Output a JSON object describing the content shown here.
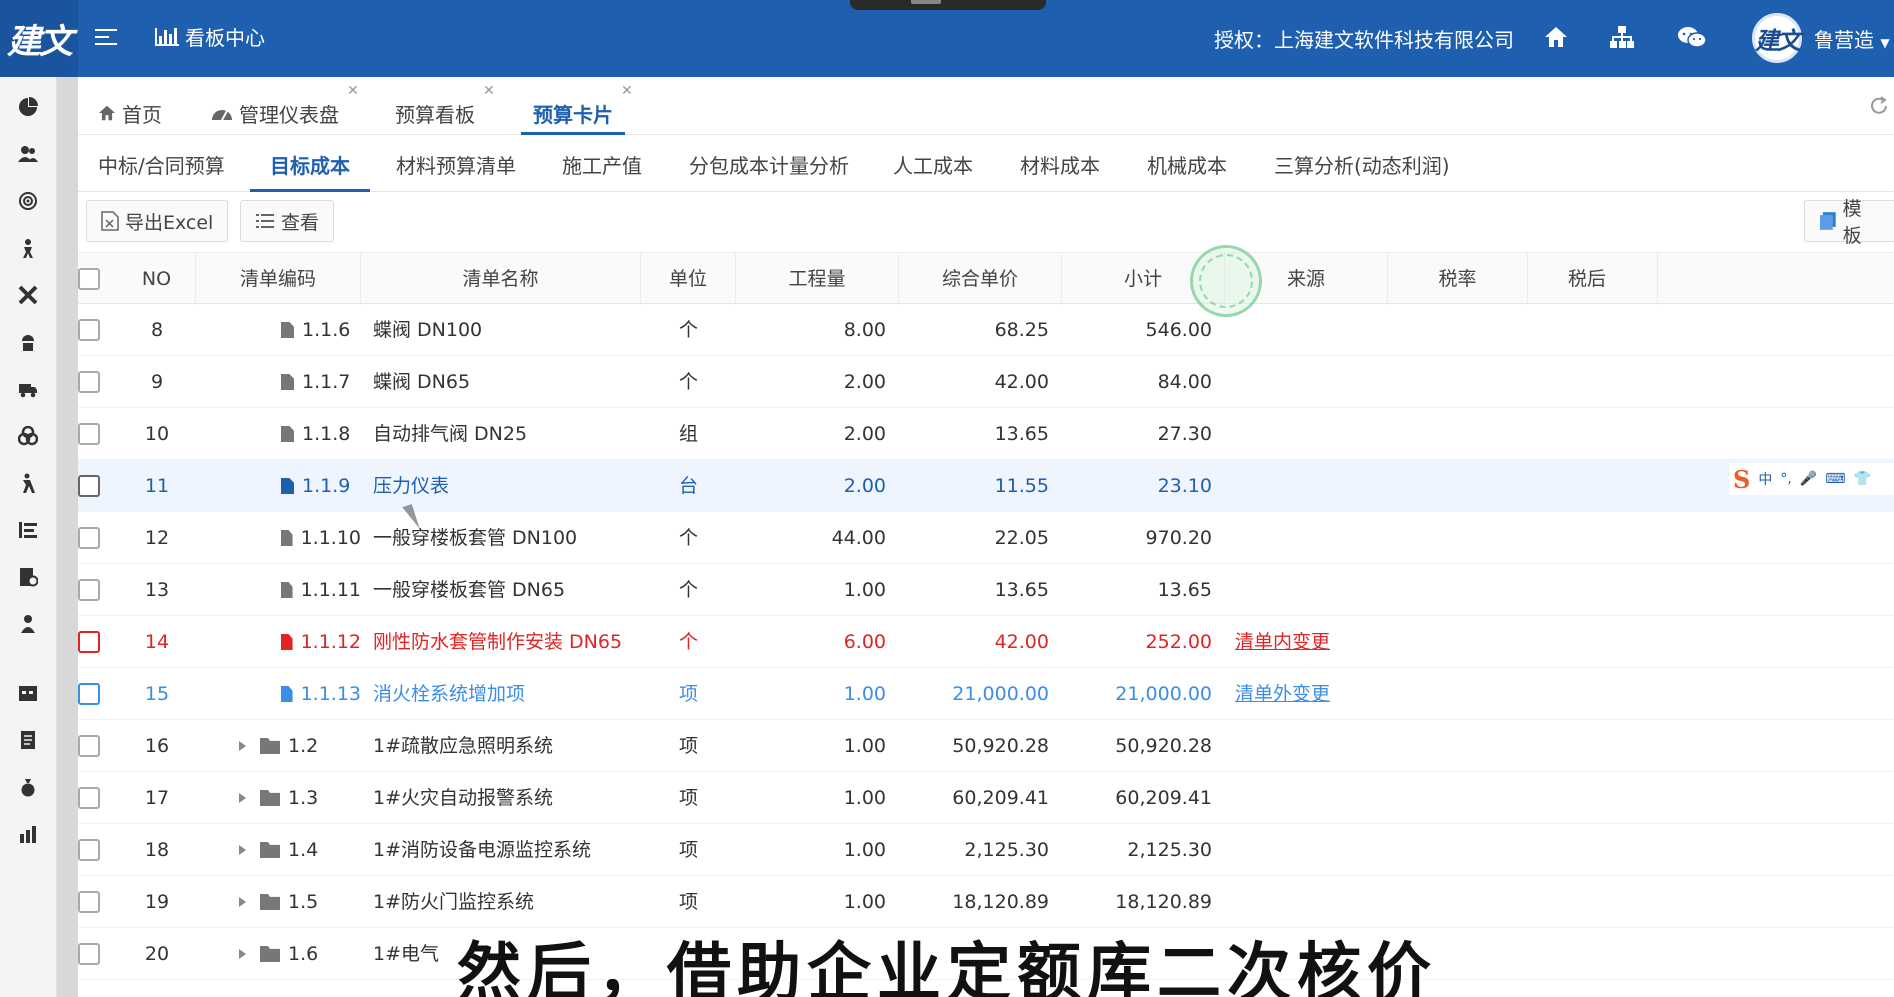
{
  "app": {
    "logo_text": "建文",
    "nav_title": "看板中心",
    "auth_text": "授权：上海建文软件科技有限公司",
    "avatar_text": "建文",
    "username": "鲁营造"
  },
  "tabs": [
    {
      "label": "首页",
      "icon": "home-icon",
      "closable": false,
      "active": false
    },
    {
      "label": "管理仪表盘",
      "icon": "dashboard-icon",
      "closable": true,
      "active": false
    },
    {
      "label": "预算看板",
      "closable": true,
      "active": false
    },
    {
      "label": "预算卡片",
      "closable": true,
      "active": true
    }
  ],
  "subtabs": [
    {
      "label": "中标/合同预算",
      "active": false
    },
    {
      "label": "目标成本",
      "active": true
    },
    {
      "label": "材料预算清单",
      "active": false
    },
    {
      "label": "施工产值",
      "active": false
    },
    {
      "label": "分包成本计量分析",
      "active": false
    },
    {
      "label": "人工成本",
      "active": false
    },
    {
      "label": "材料成本",
      "active": false
    },
    {
      "label": "机械成本",
      "active": false
    },
    {
      "label": "三算分析(动态利润)",
      "active": false
    }
  ],
  "toolbar": {
    "export_label": "导出Excel",
    "view_label": "查看",
    "template_label": "模板"
  },
  "table": {
    "headers": [
      "NO",
      "清单编码",
      "清单名称",
      "单位",
      "工程量",
      "综合单价",
      "小计",
      "来源",
      "税率",
      "税后"
    ],
    "rows": [
      {
        "no": "8",
        "code": "1.1.6",
        "name": "蝶阀 DN100",
        "unit": "个",
        "qty": "8.00",
        "price": "68.25",
        "subtotal": "546.00",
        "source": "",
        "type": "item",
        "style": "normal"
      },
      {
        "no": "9",
        "code": "1.1.7",
        "name": "蝶阀 DN65",
        "unit": "个",
        "qty": "2.00",
        "price": "42.00",
        "subtotal": "84.00",
        "source": "",
        "type": "item",
        "style": "normal"
      },
      {
        "no": "10",
        "code": "1.1.8",
        "name": "自动排气阀 DN25",
        "unit": "组",
        "qty": "2.00",
        "price": "13.65",
        "subtotal": "27.30",
        "source": "",
        "type": "item",
        "style": "normal"
      },
      {
        "no": "11",
        "code": "1.1.9",
        "name": "压力仪表",
        "unit": "台",
        "qty": "2.00",
        "price": "11.55",
        "subtotal": "23.10",
        "source": "",
        "type": "item",
        "style": "selected"
      },
      {
        "no": "12",
        "code": "1.1.10",
        "name": "一般穿楼板套管 DN100",
        "unit": "个",
        "qty": "44.00",
        "price": "22.05",
        "subtotal": "970.20",
        "source": "",
        "type": "item",
        "style": "normal"
      },
      {
        "no": "13",
        "code": "1.1.11",
        "name": "一般穿楼板套管 DN65",
        "unit": "个",
        "qty": "1.00",
        "price": "13.65",
        "subtotal": "13.65",
        "source": "",
        "type": "item",
        "style": "normal"
      },
      {
        "no": "14",
        "code": "1.1.12",
        "name": "刚性防水套管制作安装 DN65",
        "unit": "个",
        "qty": "6.00",
        "price": "42.00",
        "subtotal": "252.00",
        "source": "清单内变更",
        "type": "item",
        "style": "red"
      },
      {
        "no": "15",
        "code": "1.1.13",
        "name": "消火栓系统增加项",
        "unit": "项",
        "qty": "1.00",
        "price": "21,000.00",
        "subtotal": "21,000.00",
        "source": "清单外变更",
        "type": "item",
        "style": "blue"
      },
      {
        "no": "16",
        "code": "1.2",
        "name": "1#疏散应急照明系统",
        "unit": "项",
        "qty": "1.00",
        "price": "50,920.28",
        "subtotal": "50,920.28",
        "source": "",
        "type": "folder",
        "style": "normal"
      },
      {
        "no": "17",
        "code": "1.3",
        "name": "1#火灾自动报警系统",
        "unit": "项",
        "qty": "1.00",
        "price": "60,209.41",
        "subtotal": "60,209.41",
        "source": "",
        "type": "folder",
        "style": "normal"
      },
      {
        "no": "18",
        "code": "1.4",
        "name": "1#消防设备电源监控系统",
        "unit": "项",
        "qty": "1.00",
        "price": "2,125.30",
        "subtotal": "2,125.30",
        "source": "",
        "type": "folder",
        "style": "normal"
      },
      {
        "no": "19",
        "code": "1.5",
        "name": "1#防火门监控系统",
        "unit": "项",
        "qty": "1.00",
        "price": "18,120.89",
        "subtotal": "18,120.89",
        "source": "",
        "type": "folder",
        "style": "normal"
      },
      {
        "no": "20",
        "code": "1.6",
        "name": "1#电气",
        "unit": "",
        "qty": "",
        "price": "",
        "subtotal": "",
        "source": "",
        "type": "folder",
        "style": "normal"
      }
    ]
  },
  "ime": {
    "brand": "S",
    "mode": "中"
  },
  "subtitle": "然后，借助企业定额库二次核价",
  "colors": {
    "brand": "#1f5fb0",
    "red_row": "#e02424",
    "blue_row": "#3a8ee6",
    "selected_row": "#1f5fb0"
  }
}
